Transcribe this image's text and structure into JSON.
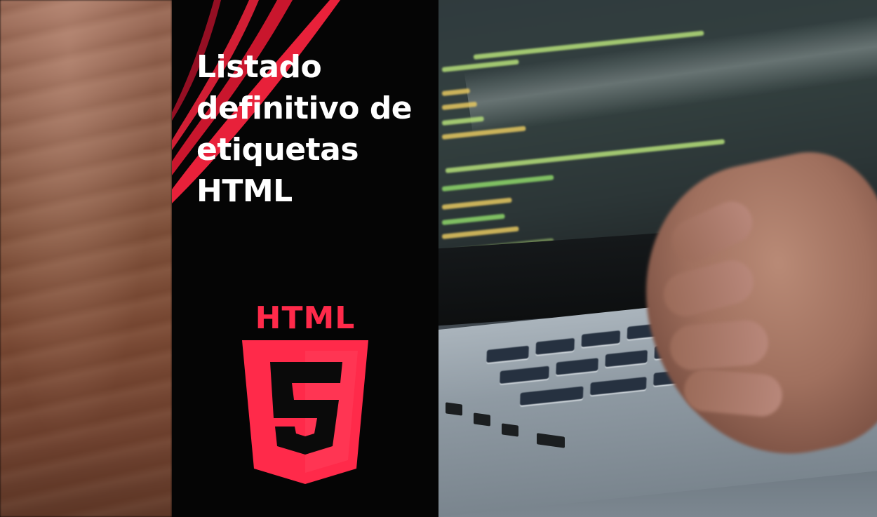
{
  "poster": {
    "title_lines": [
      "Listado",
      "definitivo de",
      "etiquetas",
      "HTML"
    ]
  },
  "logo": {
    "label": "HTML",
    "number": "5",
    "color": "#ff2a4a"
  },
  "colors": {
    "background": "#050505",
    "accent": "#e8213a",
    "text": "#ffffff"
  }
}
